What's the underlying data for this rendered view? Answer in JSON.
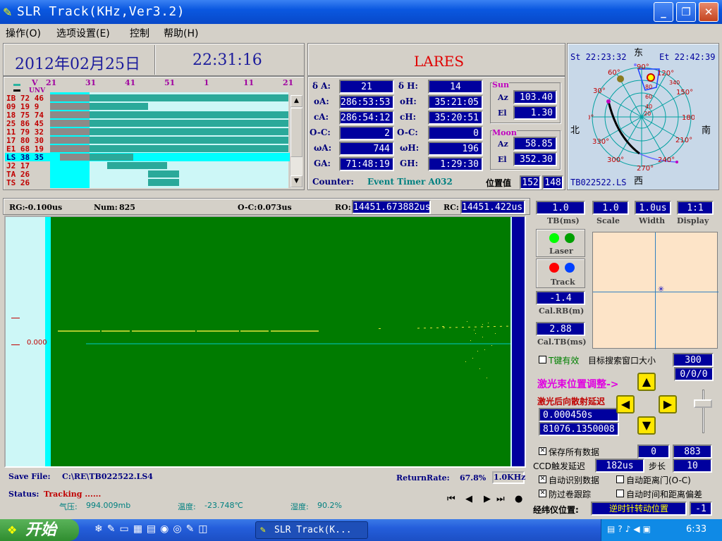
{
  "window": {
    "title": "SLR Track(KHz,Ver3.2)",
    "min": "_",
    "max": "❐",
    "close": "✕"
  },
  "menu": [
    "操作(O)",
    "选项设置(E)",
    "控制",
    "帮助(H)"
  ],
  "header": {
    "date": "2012年02月25日",
    "time": "22:31:16",
    "satellite": "LARES"
  },
  "timeline": {
    "legend_v": "V",
    "legend_unv": "UNV",
    "ticks": [
      "21",
      "31",
      "41",
      "51",
      "1",
      "11",
      "21"
    ],
    "rows": [
      {
        "name": "IB",
        "a": "72",
        "b": "46",
        "bar_start": 0.0,
        "bar_end": 1.0
      },
      {
        "name": "09",
        "a": "19",
        "b": "9",
        "bar_start": 0.0,
        "bar_end": 0.41
      },
      {
        "name": "18",
        "a": "75",
        "b": "74",
        "bar_start": 0.0,
        "bar_end": 1.0
      },
      {
        "name": "25",
        "a": "86",
        "b": "45",
        "bar_start": 0.0,
        "bar_end": 1.0
      },
      {
        "name": "11",
        "a": "79",
        "b": "32",
        "bar_start": 0.0,
        "bar_end": 1.0
      },
      {
        "name": "17",
        "a": "80",
        "b": "30",
        "bar_start": 0.0,
        "bar_end": 1.0
      },
      {
        "name": "E1",
        "a": "68",
        "b": "19",
        "bar_start": 0.0,
        "bar_end": 1.0
      },
      {
        "name": "LS",
        "a": "38",
        "b": "35",
        "bar_start": 0.04,
        "bar_end": 0.35
      },
      {
        "name": "J2",
        "a": "17",
        "b": "",
        "bar_start": 0.24,
        "bar_end": 0.49
      },
      {
        "name": "TA",
        "a": "26",
        "b": "",
        "bar_start": 0.41,
        "bar_end": 0.54
      },
      {
        "name": "TS",
        "a": "26",
        "b": "",
        "bar_start": 0.41,
        "bar_end": 0.54
      }
    ]
  },
  "params": {
    "dA_label": "δ A:",
    "dA": "21",
    "dH_label": "δ H:",
    "dH": "14",
    "oA_label": "oA:",
    "oA": "286:53:53",
    "oH_label": "oH:",
    "oH": "35:21:05",
    "cA_label": "cA:",
    "cA": "286:54:12",
    "cH_label": "cH:",
    "cH": "35:20:51",
    "oc1_label": "O-C:",
    "oc1": "2",
    "oc2_label": "O-C:",
    "oc2": "0",
    "wA_label": "ωA:",
    "wA": "744",
    "wH_label": "ωH:",
    "wH": "196",
    "GA_label": "GA:",
    "GA": "71:48:19",
    "GH_label": "GH:",
    "GH": "1:29:30",
    "counter_label": "Counter:",
    "counter_value": "Event Timer A032",
    "pos_label": "位置值",
    "pos1": "152",
    "pos2": "148"
  },
  "sun": {
    "title": "Sun",
    "az_label": "Az",
    "az": "103.40",
    "el_label": "El",
    "el": "1.30"
  },
  "moon": {
    "title": "Moon",
    "az_label": "Az",
    "az": "58.85",
    "el_label": "El",
    "el": "352.30"
  },
  "polar": {
    "st": "St 22:23:32",
    "et": "Et 22:42:39",
    "east": "东",
    "south": "南",
    "west": "西",
    "north": "北",
    "file": "TB022522.LS",
    "deg_labels": [
      "90°",
      "120°",
      "60°",
      "150°",
      "30°",
      "180°",
      "0°",
      "210°",
      "330°",
      "240°",
      "300°",
      "270°"
    ],
    "ring_labels": [
      "0",
      "20",
      "40",
      "60",
      "80",
      "340"
    ]
  },
  "scope": {
    "rg_label": "RG:",
    "rg": "-0.100us",
    "num_label": "Num:",
    "num": "825",
    "oc_label": "O-C:",
    "oc": "0.073us",
    "ro_label": "RO:",
    "ro": "14451.673882us",
    "rc_label": "RC:",
    "rc": "14451.422us",
    "ylabel": "0.000",
    "save_label": "Save File:",
    "save_path": "C:\\RE\\TB022522.LS4",
    "rr_label": "ReturnRate:",
    "rr": "67.8%",
    "freq": "1.0KHz",
    "status_label": "Status:",
    "status": "Tracking ......",
    "pressure_label": "气压:",
    "pressure": "994.009mb",
    "temp_label": "温度:",
    "temp": "-23.748℃",
    "hum_label": "湿度:",
    "hum": "90.2%",
    "ctrl": [
      "⏮",
      "◀",
      "▶",
      "⏭",
      "●"
    ]
  },
  "right": {
    "tb": "1.0",
    "tb_label": "TB(ms)",
    "scale": "1.0",
    "scale_label": "Scale",
    "width": "1.0us",
    "width_label": "Width",
    "display": "1:1",
    "display_label": "Display",
    "laser_label": "Laser",
    "track_label": "Track",
    "calrb": "-1.4",
    "calrb_label": "Cal.RB(m)",
    "caltb": "2.88",
    "caltb_label": "Cal.TB(ms)",
    "tkey_label": "T键有效",
    "search_label": "目标搜索窗口大小",
    "search": "300",
    "search2": "0/0/0",
    "beam_label": "激光束位置调整->",
    "backscatter_label": "激光后向散射延迟",
    "bs1": "0.000450s",
    "bs2": "81076.1350008",
    "save_all_label": "保存所有数据",
    "save_v1": "0",
    "save_v2": "883",
    "ccd_label": "CCD触发延迟",
    "ccd": "182us",
    "step_label": "步长",
    "step": "10",
    "auto_id_label": "自动识别数据",
    "auto_gate_label": "自动距离门(O-C)",
    "anti_label": "防过卷跟踪",
    "auto_bias_label": "自动时间和距离偏差",
    "theo_label": "经纬仪位置:",
    "theo": "逆时针转动位置",
    "theo_v": "-1"
  },
  "taskbar": {
    "start": "开始",
    "task": "SLR Track(K...",
    "clock": "6:33"
  }
}
